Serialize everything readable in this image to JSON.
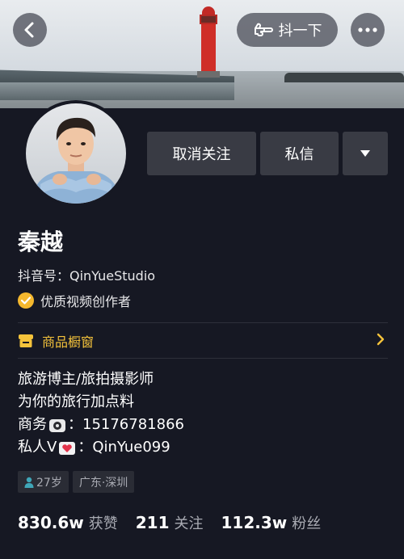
{
  "header": {
    "back_icon": "chevron-left-icon",
    "shake_label": "抖一下",
    "shake_icon": "pointing-hand-icon",
    "more_icon": "ellipsis-icon"
  },
  "actions": {
    "unfollow_label": "取消关注",
    "message_label": "私信",
    "dropdown_icon": "triangle-down-icon"
  },
  "profile": {
    "name": "秦越",
    "douyin_id": "抖音号：QinYueStudio",
    "verified_label": "优质视频创作者"
  },
  "shop": {
    "label": "商品橱窗",
    "icon": "storefront-icon",
    "chevron_icon": "chevron-right-icon",
    "accent_color": "#f5c33b"
  },
  "bio": {
    "line1": "旅游博主/旅拍摄影师",
    "line2": "为你的旅行加点料",
    "line3_prefix": "商务",
    "line3_value": "：15176781866",
    "line4_prefix": "私人V",
    "line4_value": "：QinYue099"
  },
  "tags": {
    "age": "27岁",
    "location": "广东·深圳"
  },
  "stats": {
    "likes_num": "830.6w",
    "likes_label": "获赞",
    "following_num": "211",
    "following_label": "关注",
    "followers_num": "112.3w",
    "followers_label": "粉丝"
  }
}
